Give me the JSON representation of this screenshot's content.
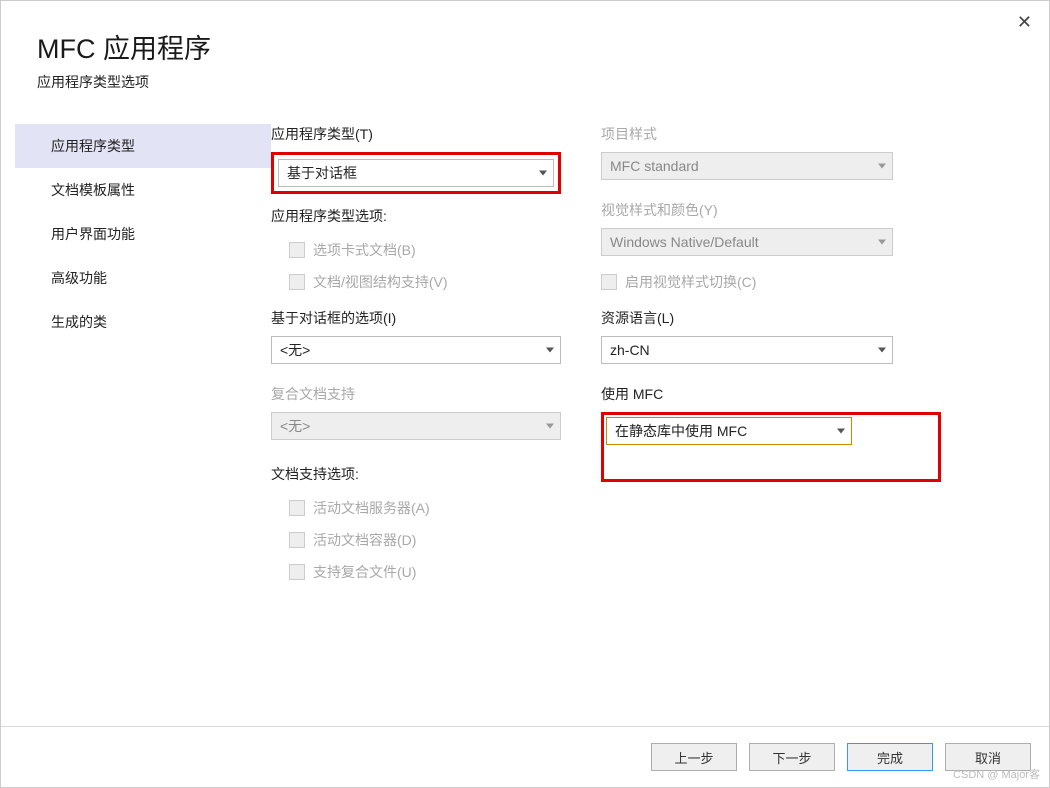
{
  "header": {
    "title": "MFC 应用程序",
    "subtitle": "应用程序类型选项"
  },
  "close": "✕",
  "sidebar": {
    "items": [
      {
        "label": "应用程序类型",
        "active": true
      },
      {
        "label": "文档模板属性"
      },
      {
        "label": "用户界面功能"
      },
      {
        "label": "高级功能"
      },
      {
        "label": "生成的类"
      }
    ]
  },
  "left": {
    "app_type_label": "应用程序类型(T)",
    "app_type_value": "基于对话框",
    "app_type_options_label": "应用程序类型选项:",
    "tabbed_doc": "选项卡式文档(B)",
    "docview": "文档/视图结构支持(V)",
    "dialog_options_label": "基于对话框的选项(I)",
    "dialog_options_value": "<无>",
    "compound_label": "复合文档支持",
    "compound_value": "<无>",
    "doc_support_label": "文档支持选项:",
    "active_server": "活动文档服务器(A)",
    "active_container": "活动文档容器(D)",
    "support_compound": "支持复合文件(U)"
  },
  "right": {
    "project_style_label": "项目样式",
    "project_style_value": "MFC standard",
    "visual_style_label": "视觉样式和颜色(Y)",
    "visual_style_value": "Windows Native/Default",
    "enable_visual_switch": "启用视觉样式切换(C)",
    "resource_lang_label": "资源语言(L)",
    "resource_lang_value": "zh-CN",
    "use_mfc_label": "使用 MFC",
    "use_mfc_value": "在静态库中使用 MFC"
  },
  "footer": {
    "back": "上一步",
    "next": "下一步",
    "finish": "完成",
    "cancel": "取消"
  },
  "watermark": "CSDN @ Major客"
}
